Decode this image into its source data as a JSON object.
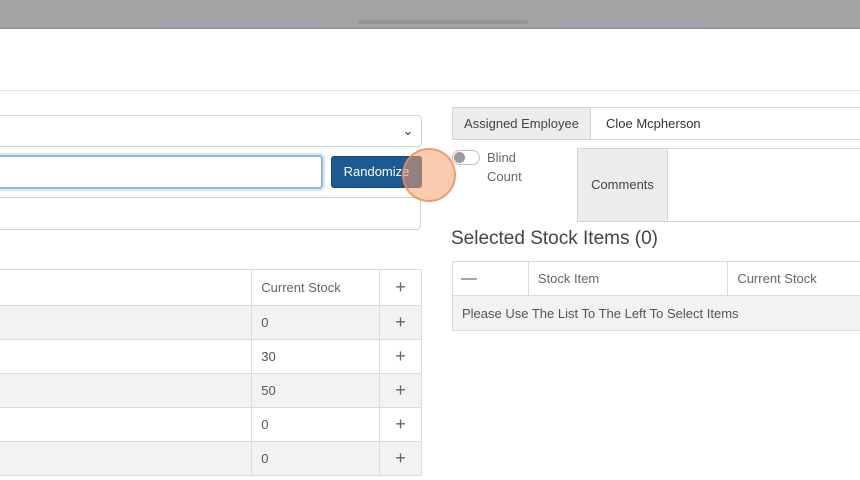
{
  "buttons": {
    "randomize": "Randomize"
  },
  "left_table": {
    "headers": [
      "",
      "Current Stock",
      "+"
    ],
    "rows": [
      {
        "name": "",
        "stock": "0",
        "add": "+"
      },
      {
        "name": "",
        "stock": "30",
        "add": "+"
      },
      {
        "name": "",
        "stock": "50",
        "add": "+"
      },
      {
        "name": "",
        "stock": "0",
        "add": "+"
      },
      {
        "name": "",
        "stock": "0",
        "add": "+"
      }
    ]
  },
  "assigned_employee": {
    "label": "Assigned Employee",
    "value": "Cloe Mcpherson"
  },
  "blind_count": {
    "label_line1": "Blind",
    "label_line2": "Count",
    "enabled": false
  },
  "comments": {
    "label": "Comments",
    "value": ""
  },
  "selected": {
    "title": "Selected Stock Items (0)",
    "headers": [
      "—",
      "Stock Item",
      "Current Stock"
    ],
    "empty_message": "Please Use The List To The Left To Select Items"
  },
  "colors": {
    "primary_button": "#1c5a93",
    "focus_border": "#8fb7e6",
    "cursor_highlight": "#f7a06e"
  }
}
